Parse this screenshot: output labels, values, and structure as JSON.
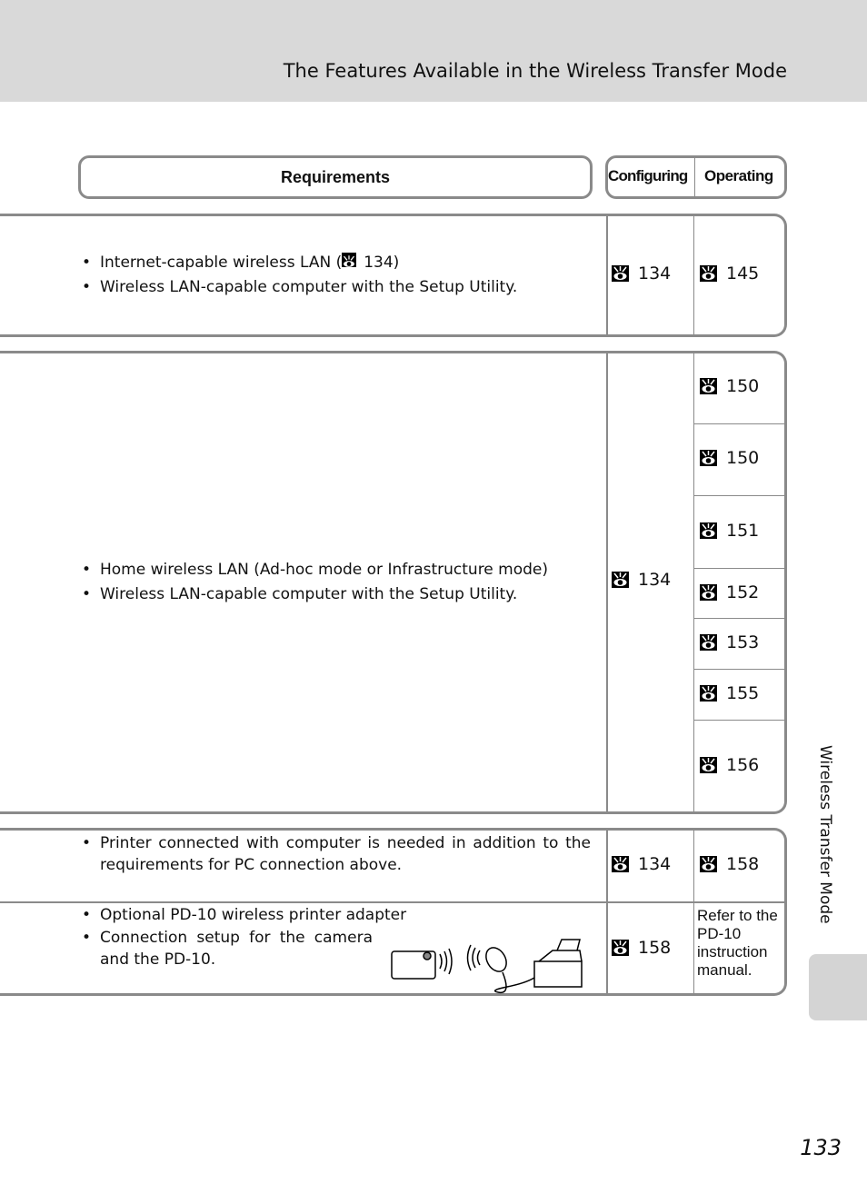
{
  "header": {
    "title": "The Features Available in the Wireless Transfer Mode"
  },
  "columns": {
    "requirements": "Requirements",
    "configuring": "Configuring",
    "operating": "Operating"
  },
  "icon": "page-reference-icon",
  "rows": [
    {
      "requirements": [
        "Internet-capable wireless LAN (",
        "134)",
        "Wireless LAN-capable computer with the Setup Utility."
      ],
      "configuring": "134",
      "operating": [
        "145"
      ]
    },
    {
      "requirements": [
        "Home wireless LAN (Ad-hoc mode or Infrastructure mode)",
        "Wireless LAN-capable computer with the Setup Utility."
      ],
      "configuring": "134",
      "operating": [
        "150",
        "150",
        "151",
        "152",
        "153",
        "155",
        "156"
      ]
    },
    {
      "requirements": [
        "Printer connected with computer is needed in addition to the requirements for PC connection above."
      ],
      "configuring": "134",
      "operating": [
        "158"
      ]
    },
    {
      "requirements": [
        "Optional PD-10 wireless printer adapter",
        "Connection setup for the camera and the PD-10."
      ],
      "configuring": "158",
      "operating_text": "Refer to the PD-10 instruction manual."
    }
  ],
  "side_tab": "Wireless Transfer Mode",
  "page_number": "133"
}
